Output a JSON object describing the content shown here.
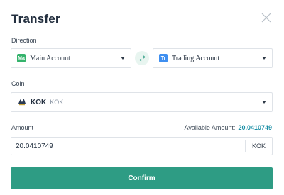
{
  "dialog": {
    "title": "Transfer"
  },
  "direction": {
    "label": "Direction",
    "from": {
      "badge": "Ma",
      "name": "Main Account"
    },
    "to": {
      "badge": "Tr",
      "name": "Trading Account"
    }
  },
  "coin": {
    "label": "Coin",
    "symbol": "KOK",
    "name": "KOK"
  },
  "amount": {
    "label": "Amount",
    "available_label": "Available Amount:",
    "available_value": "20.0410749",
    "value": "20.0410749",
    "unit": "KOK"
  },
  "confirm_label": "Confirm",
  "icons": {
    "close": "close-icon",
    "swap": "swap-arrows-icon",
    "coin": "kok-coin-icon"
  },
  "colors": {
    "accent": "#2e9c84",
    "available_value": "#1b8fa6",
    "main_badge": "#35b36c",
    "trade_badge": "#3f8ff0"
  }
}
